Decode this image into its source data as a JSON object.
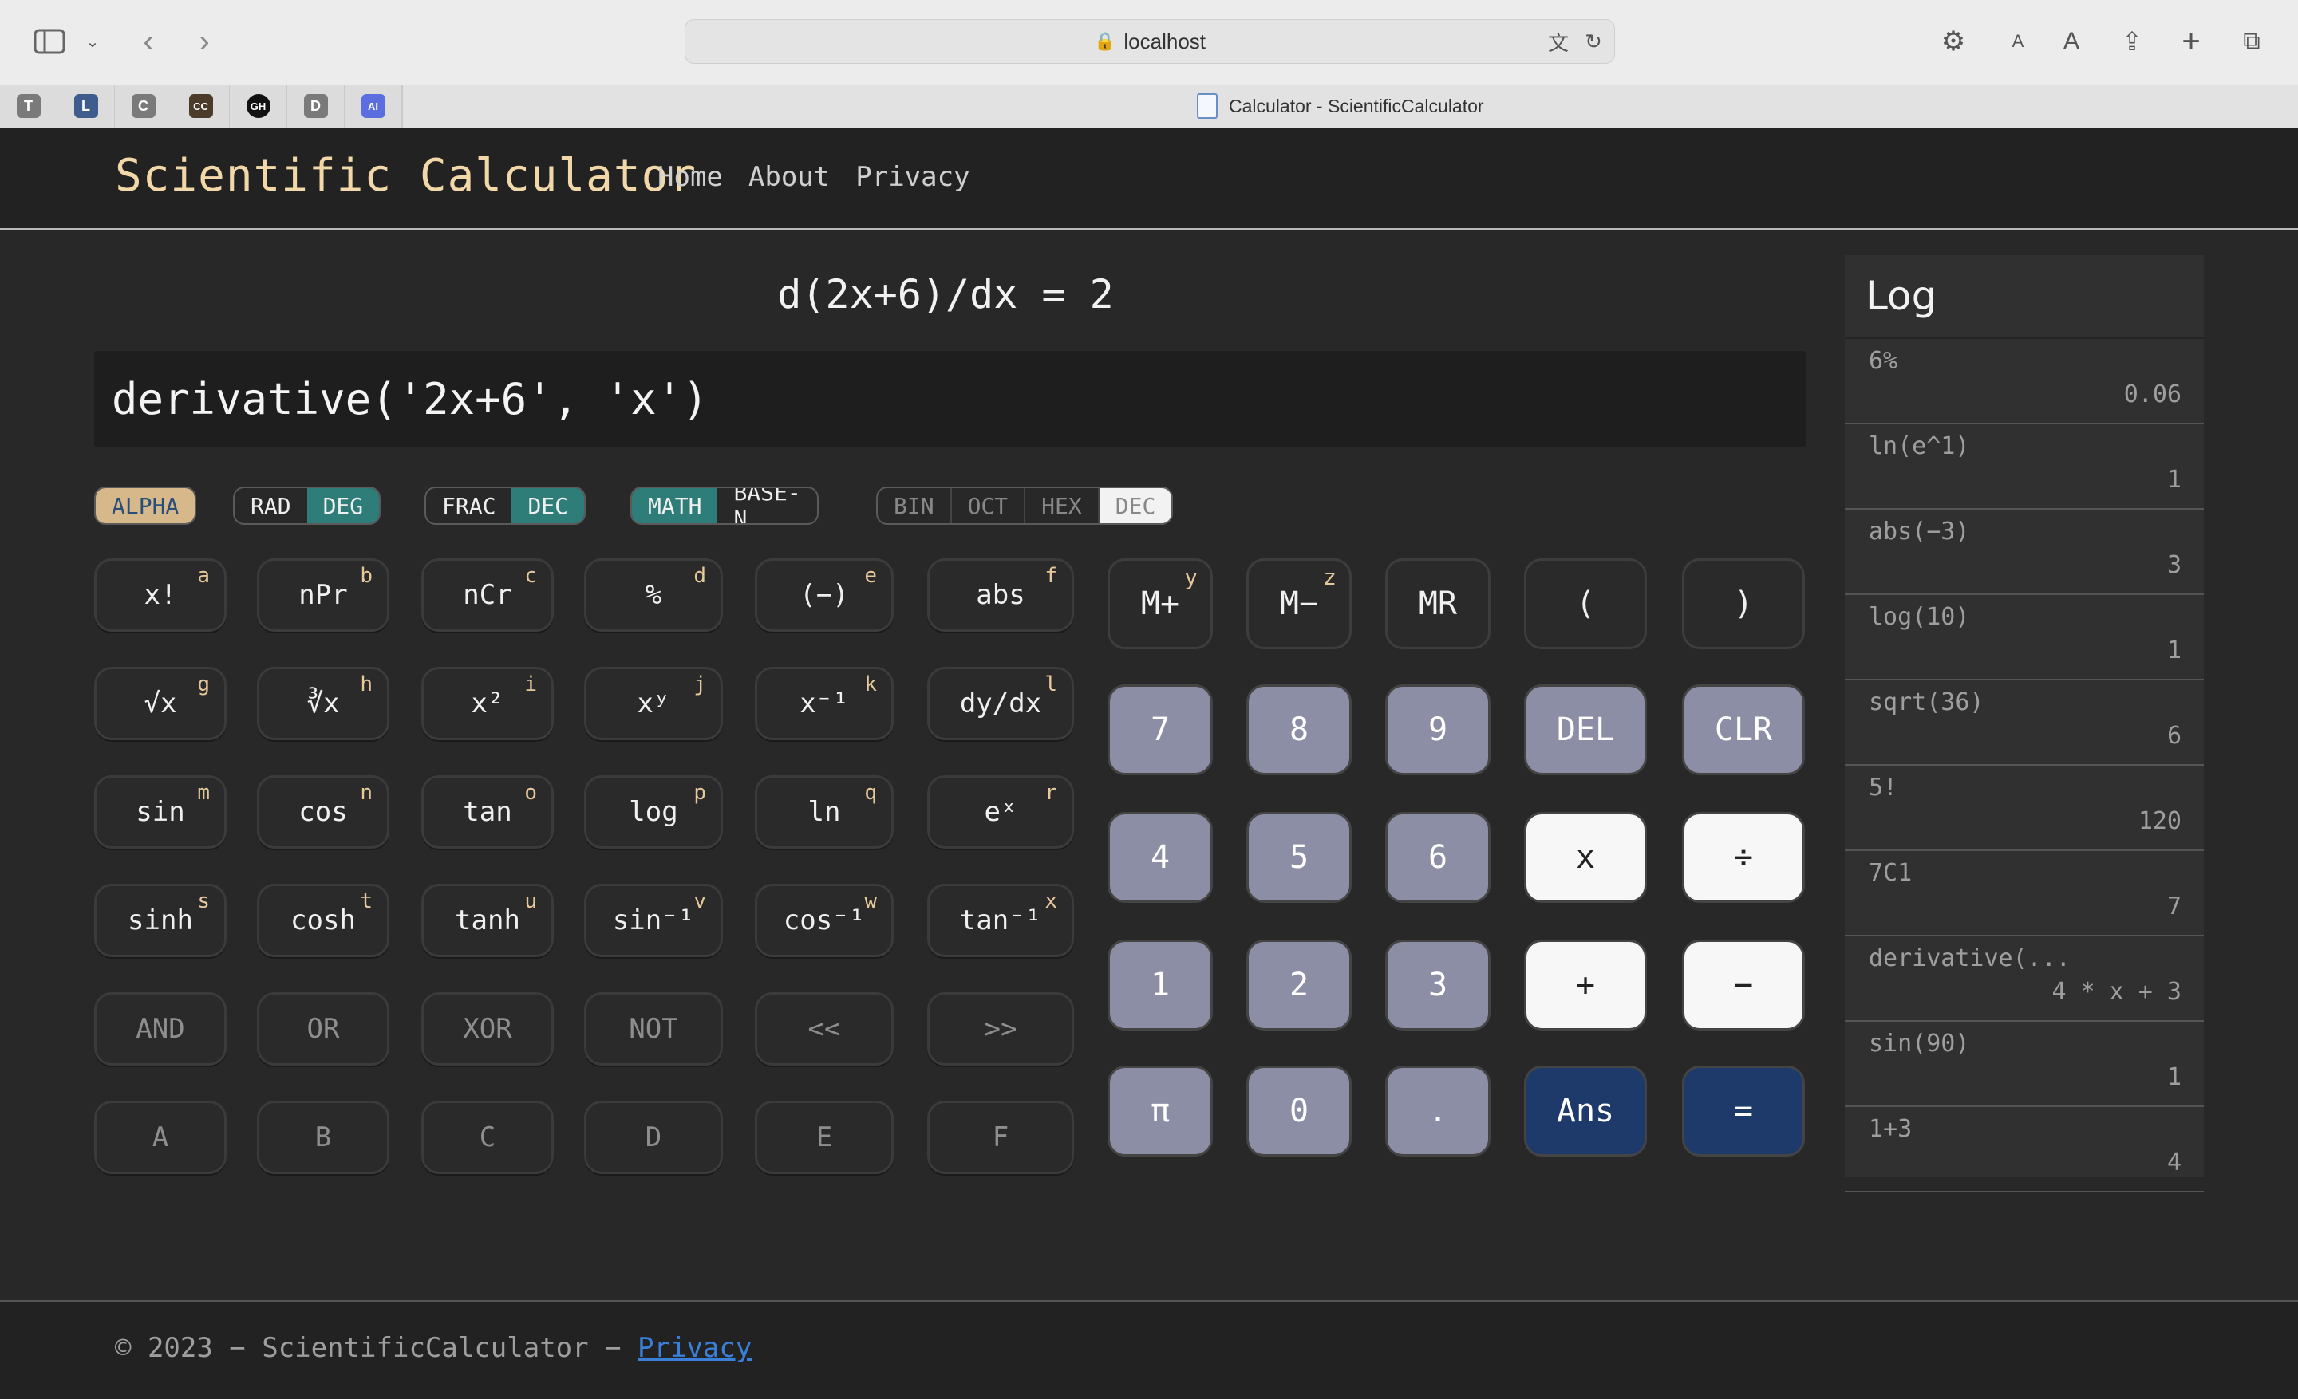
{
  "browser": {
    "url": "localhost",
    "tab_title": "Calculator - ScientificCalculator",
    "favorites": [
      "T",
      "L",
      "C",
      "CC",
      "GH",
      "D",
      "AI"
    ]
  },
  "header": {
    "brand": "Scientific Calculator",
    "nav": [
      "Home",
      "About",
      "Privacy"
    ]
  },
  "display": {
    "result": "d(2x+6)/dx = 2",
    "input": "derivative('2x+6', 'x')"
  },
  "toggles": {
    "alpha": "ALPHA",
    "angle": [
      "RAD",
      "DEG"
    ],
    "format": [
      "FRAC",
      "DEC"
    ],
    "mode": [
      "MATH",
      "BASE-N"
    ],
    "base": [
      "BIN",
      "OCT",
      "HEX",
      "DEC"
    ]
  },
  "sci_keys": [
    [
      "x!",
      "a"
    ],
    [
      "nPr",
      "b"
    ],
    [
      "nCr",
      "c"
    ],
    [
      "%",
      "d"
    ],
    [
      "(−)",
      "e"
    ],
    [
      "abs",
      "f"
    ],
    [
      "√x",
      "g"
    ],
    [
      "∛x",
      "h"
    ],
    [
      "x²",
      "i"
    ],
    [
      "xʸ",
      "j"
    ],
    [
      "x⁻¹",
      "k"
    ],
    [
      "dy/dx",
      "l"
    ],
    [
      "sin",
      "m"
    ],
    [
      "cos",
      "n"
    ],
    [
      "tan",
      "o"
    ],
    [
      "log",
      "p"
    ],
    [
      "ln",
      "q"
    ],
    [
      "eˣ",
      "r"
    ],
    [
      "sinh",
      "s"
    ],
    [
      "cosh",
      "t"
    ],
    [
      "tanh",
      "u"
    ],
    [
      "sin⁻¹",
      "v"
    ],
    [
      "cos⁻¹",
      "w"
    ],
    [
      "tan⁻¹",
      "x"
    ],
    [
      "AND",
      ""
    ],
    [
      "OR",
      ""
    ],
    [
      "XOR",
      ""
    ],
    [
      "NOT",
      ""
    ],
    [
      "<<",
      ""
    ],
    [
      ">>",
      ""
    ],
    [
      "A",
      ""
    ],
    [
      "B",
      ""
    ],
    [
      "C",
      ""
    ],
    [
      "D",
      ""
    ],
    [
      "E",
      ""
    ],
    [
      "F",
      ""
    ]
  ],
  "num_keys": [
    [
      "M+",
      "y"
    ],
    [
      "M−",
      "z"
    ],
    [
      "MR",
      ""
    ],
    [
      "(",
      ""
    ],
    [
      ")",
      ""
    ],
    [
      "7",
      ""
    ],
    [
      "8",
      ""
    ],
    [
      "9",
      ""
    ],
    [
      "DEL",
      ""
    ],
    [
      "CLR",
      ""
    ],
    [
      "4",
      ""
    ],
    [
      "5",
      ""
    ],
    [
      "6",
      ""
    ],
    [
      "x",
      ""
    ],
    [
      "÷",
      ""
    ],
    [
      "1",
      ""
    ],
    [
      "2",
      ""
    ],
    [
      "3",
      ""
    ],
    [
      "+",
      ""
    ],
    [
      "−",
      ""
    ],
    [
      "π",
      ""
    ],
    [
      "0",
      ""
    ],
    [
      ".",
      ""
    ],
    [
      "Ans",
      ""
    ],
    [
      "=",
      ""
    ]
  ],
  "log": {
    "title": "Log",
    "entries": [
      {
        "q": "6%",
        "a": "0.06"
      },
      {
        "q": "ln(e^1)",
        "a": "1"
      },
      {
        "q": "abs(−3)",
        "a": "3"
      },
      {
        "q": "log(10)",
        "a": "1"
      },
      {
        "q": "sqrt(36)",
        "a": "6"
      },
      {
        "q": "5!",
        "a": "120"
      },
      {
        "q": "7C1",
        "a": "7"
      },
      {
        "q": "derivative(...",
        "a": "4 * x + 3"
      },
      {
        "q": "sin(90)",
        "a": "1"
      },
      {
        "q": "1+3",
        "a": "4"
      }
    ]
  },
  "footer": {
    "text": "© 2023 − ScientificCalculator − ",
    "link": "Privacy"
  }
}
